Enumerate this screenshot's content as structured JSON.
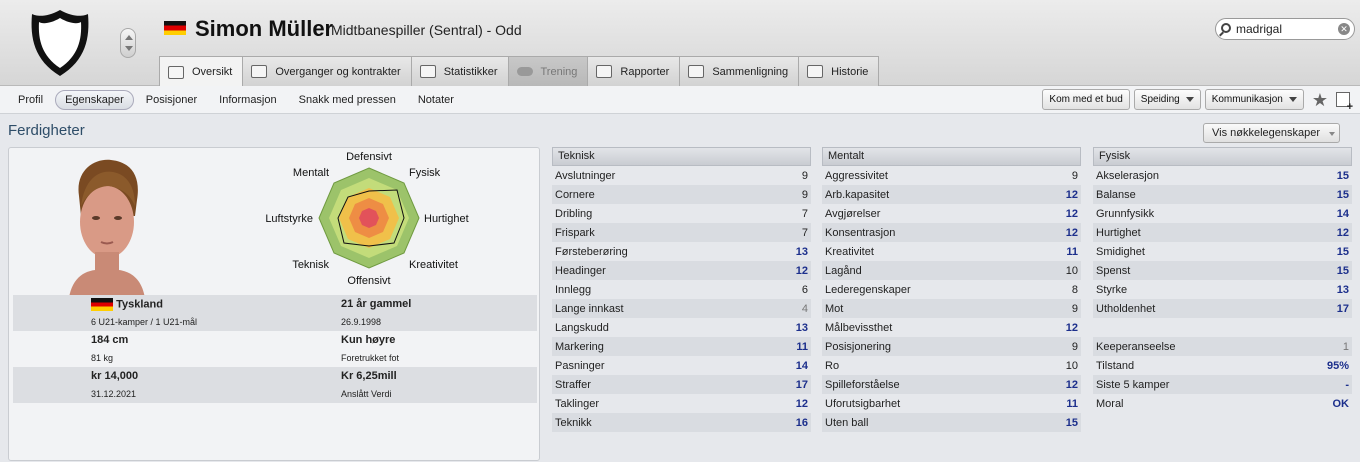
{
  "player": {
    "name": "Simon Müller",
    "subtitle": "Midtbanespiller (Sentral) - Odd",
    "nationality_flag": "germany-flag"
  },
  "search": {
    "value": "madrigal"
  },
  "tabs": [
    {
      "label": "Oversikt",
      "active": true
    },
    {
      "label": "Overganger og kontrakter"
    },
    {
      "label": "Statistikker"
    },
    {
      "label": "Trening",
      "disabled": true
    },
    {
      "label": "Rapporter"
    },
    {
      "label": "Sammenligning"
    },
    {
      "label": "Historie"
    }
  ],
  "subnav": [
    "Profil",
    "Egenskaper",
    "Posisjoner",
    "Informasjon",
    "Snakk med pressen",
    "Notater"
  ],
  "actions": {
    "offer": "Kom med et bud",
    "scouting": "Speiding",
    "communication": "Kommunikasjon"
  },
  "section": {
    "title": "Ferdigheter",
    "key_button": "Vis nøkkelegenskaper"
  },
  "radar": {
    "labels": [
      "Defensivt",
      "Fysisk",
      "Hurtighet",
      "Kreativitet",
      "Offensivt",
      "Teknisk",
      "Luftstyrke",
      "Mentalt"
    ]
  },
  "info": {
    "nation": "Tyskland",
    "age": "21 år gammel",
    "caps": "6 U21-kamper / 1 U21-mål",
    "dob": "26.9.1998",
    "height": "184 cm",
    "foot": "Kun høyre",
    "weight": "81 kg",
    "foot_label": "Foretrukket fot",
    "wage": "kr 14,000",
    "value": "Kr 6,25mill",
    "contract": "31.12.2021",
    "value_label": "Anslått Verdi"
  },
  "columns": [
    {
      "title": "Teknisk",
      "items": [
        [
          "Avslutninger",
          "9"
        ],
        [
          "Cornere",
          "9"
        ],
        [
          "Dribling",
          "7"
        ],
        [
          "Frispark",
          "7"
        ],
        [
          "Førsteberøring",
          "13"
        ],
        [
          "Headinger",
          "12"
        ],
        [
          "Innlegg",
          "6"
        ],
        [
          "Lange innkast",
          "4"
        ],
        [
          "Langskudd",
          "13"
        ],
        [
          "Markering",
          "11"
        ],
        [
          "Pasninger",
          "14"
        ],
        [
          "Straffer",
          "17"
        ],
        [
          "Taklinger",
          "12"
        ],
        [
          "Teknikk",
          "16"
        ]
      ]
    },
    {
      "title": "Mentalt",
      "items": [
        [
          "Aggressivitet",
          "9"
        ],
        [
          "Arb.kapasitet",
          "12"
        ],
        [
          "Avgjørelser",
          "12"
        ],
        [
          "Konsentrasjon",
          "12"
        ],
        [
          "Kreativitet",
          "11"
        ],
        [
          "Lagånd",
          "10"
        ],
        [
          "Lederegenskaper",
          "8"
        ],
        [
          "Mot",
          "9"
        ],
        [
          "Målbevissthet",
          "12"
        ],
        [
          "Posisjonering",
          "9"
        ],
        [
          "Ro",
          "10"
        ],
        [
          "Spilleforståelse",
          "12"
        ],
        [
          "Uforutsigbarhet",
          "11"
        ],
        [
          "Uten ball",
          "15"
        ]
      ]
    },
    {
      "title": "Fysisk",
      "items": [
        [
          "Akselerasjon",
          "15"
        ],
        [
          "Balanse",
          "15"
        ],
        [
          "Grunnfysikk",
          "14"
        ],
        [
          "Hurtighet",
          "12"
        ],
        [
          "Smidighet",
          "15"
        ],
        [
          "Spenst",
          "15"
        ],
        [
          "Styrke",
          "13"
        ],
        [
          "Utholdenhet",
          "17"
        ],
        [
          "",
          ""
        ],
        [
          "Keeperanseelse",
          "1"
        ],
        [
          "Tilstand",
          "95%"
        ],
        [
          "Siste 5 kamper",
          "-"
        ],
        [
          "Moral",
          "OK"
        ]
      ]
    }
  ]
}
